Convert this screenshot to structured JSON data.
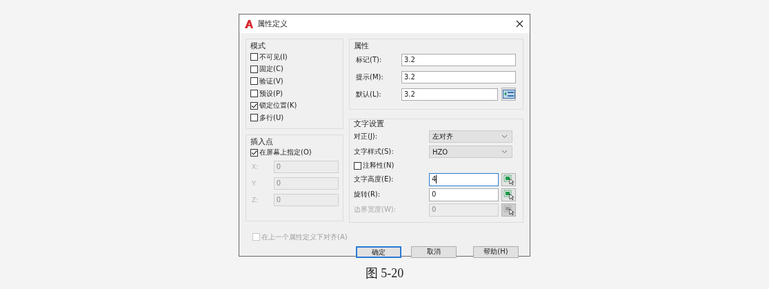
{
  "window": {
    "title": "属性定义"
  },
  "mode": {
    "title": "模式",
    "options": [
      {
        "label": "不可见(I)",
        "checked": false
      },
      {
        "label": "固定(C)",
        "checked": false
      },
      {
        "label": "验证(V)",
        "checked": false
      },
      {
        "label": "预设(P)",
        "checked": false
      },
      {
        "label": "锁定位置(K)",
        "checked": true
      },
      {
        "label": "多行(U)",
        "checked": false
      }
    ]
  },
  "insertion_point": {
    "title": "插入点",
    "specify_on_screen": {
      "label": "在屏幕上指定(O)",
      "checked": true
    },
    "coords": [
      {
        "label": "X:",
        "value": "0",
        "disabled": true
      },
      {
        "label": "Y:",
        "value": "0",
        "disabled": true
      },
      {
        "label": "Z:",
        "value": "0",
        "disabled": true
      }
    ]
  },
  "attribute": {
    "title": "属性",
    "fields": [
      {
        "label": "标记(T):",
        "value": "3.2",
        "button": false
      },
      {
        "label": "提示(M):",
        "value": "3.2",
        "button": false
      },
      {
        "label": "默认(L):",
        "value": "3.2",
        "button": true
      }
    ]
  },
  "text_settings": {
    "title": "文字设置",
    "rows": [
      {
        "kind": "dropdown",
        "label": "对正(J):",
        "value": "左对齐"
      },
      {
        "kind": "dropdown",
        "label": "文字样式(S):",
        "value": "HZO"
      },
      {
        "kind": "checkbox",
        "label": "注释性(N)",
        "checked": false
      },
      {
        "kind": "input",
        "label": "文字高度(E):",
        "value": "4",
        "disabled": false,
        "focused": true
      },
      {
        "kind": "input",
        "label": "旋转(R):",
        "value": "0",
        "disabled": false,
        "focused": false
      },
      {
        "kind": "input",
        "label": "边界宽度(W):",
        "value": "0",
        "disabled": true,
        "focused": false
      }
    ]
  },
  "align_below": {
    "label": "在上一个属性定义下对齐(A)",
    "checked": false,
    "disabled": true
  },
  "buttons": [
    {
      "label": "确定",
      "default": true
    },
    {
      "label": "取消",
      "default": false
    },
    {
      "label": "帮助(H)",
      "default": false
    }
  ],
  "caption": "图 5-20"
}
